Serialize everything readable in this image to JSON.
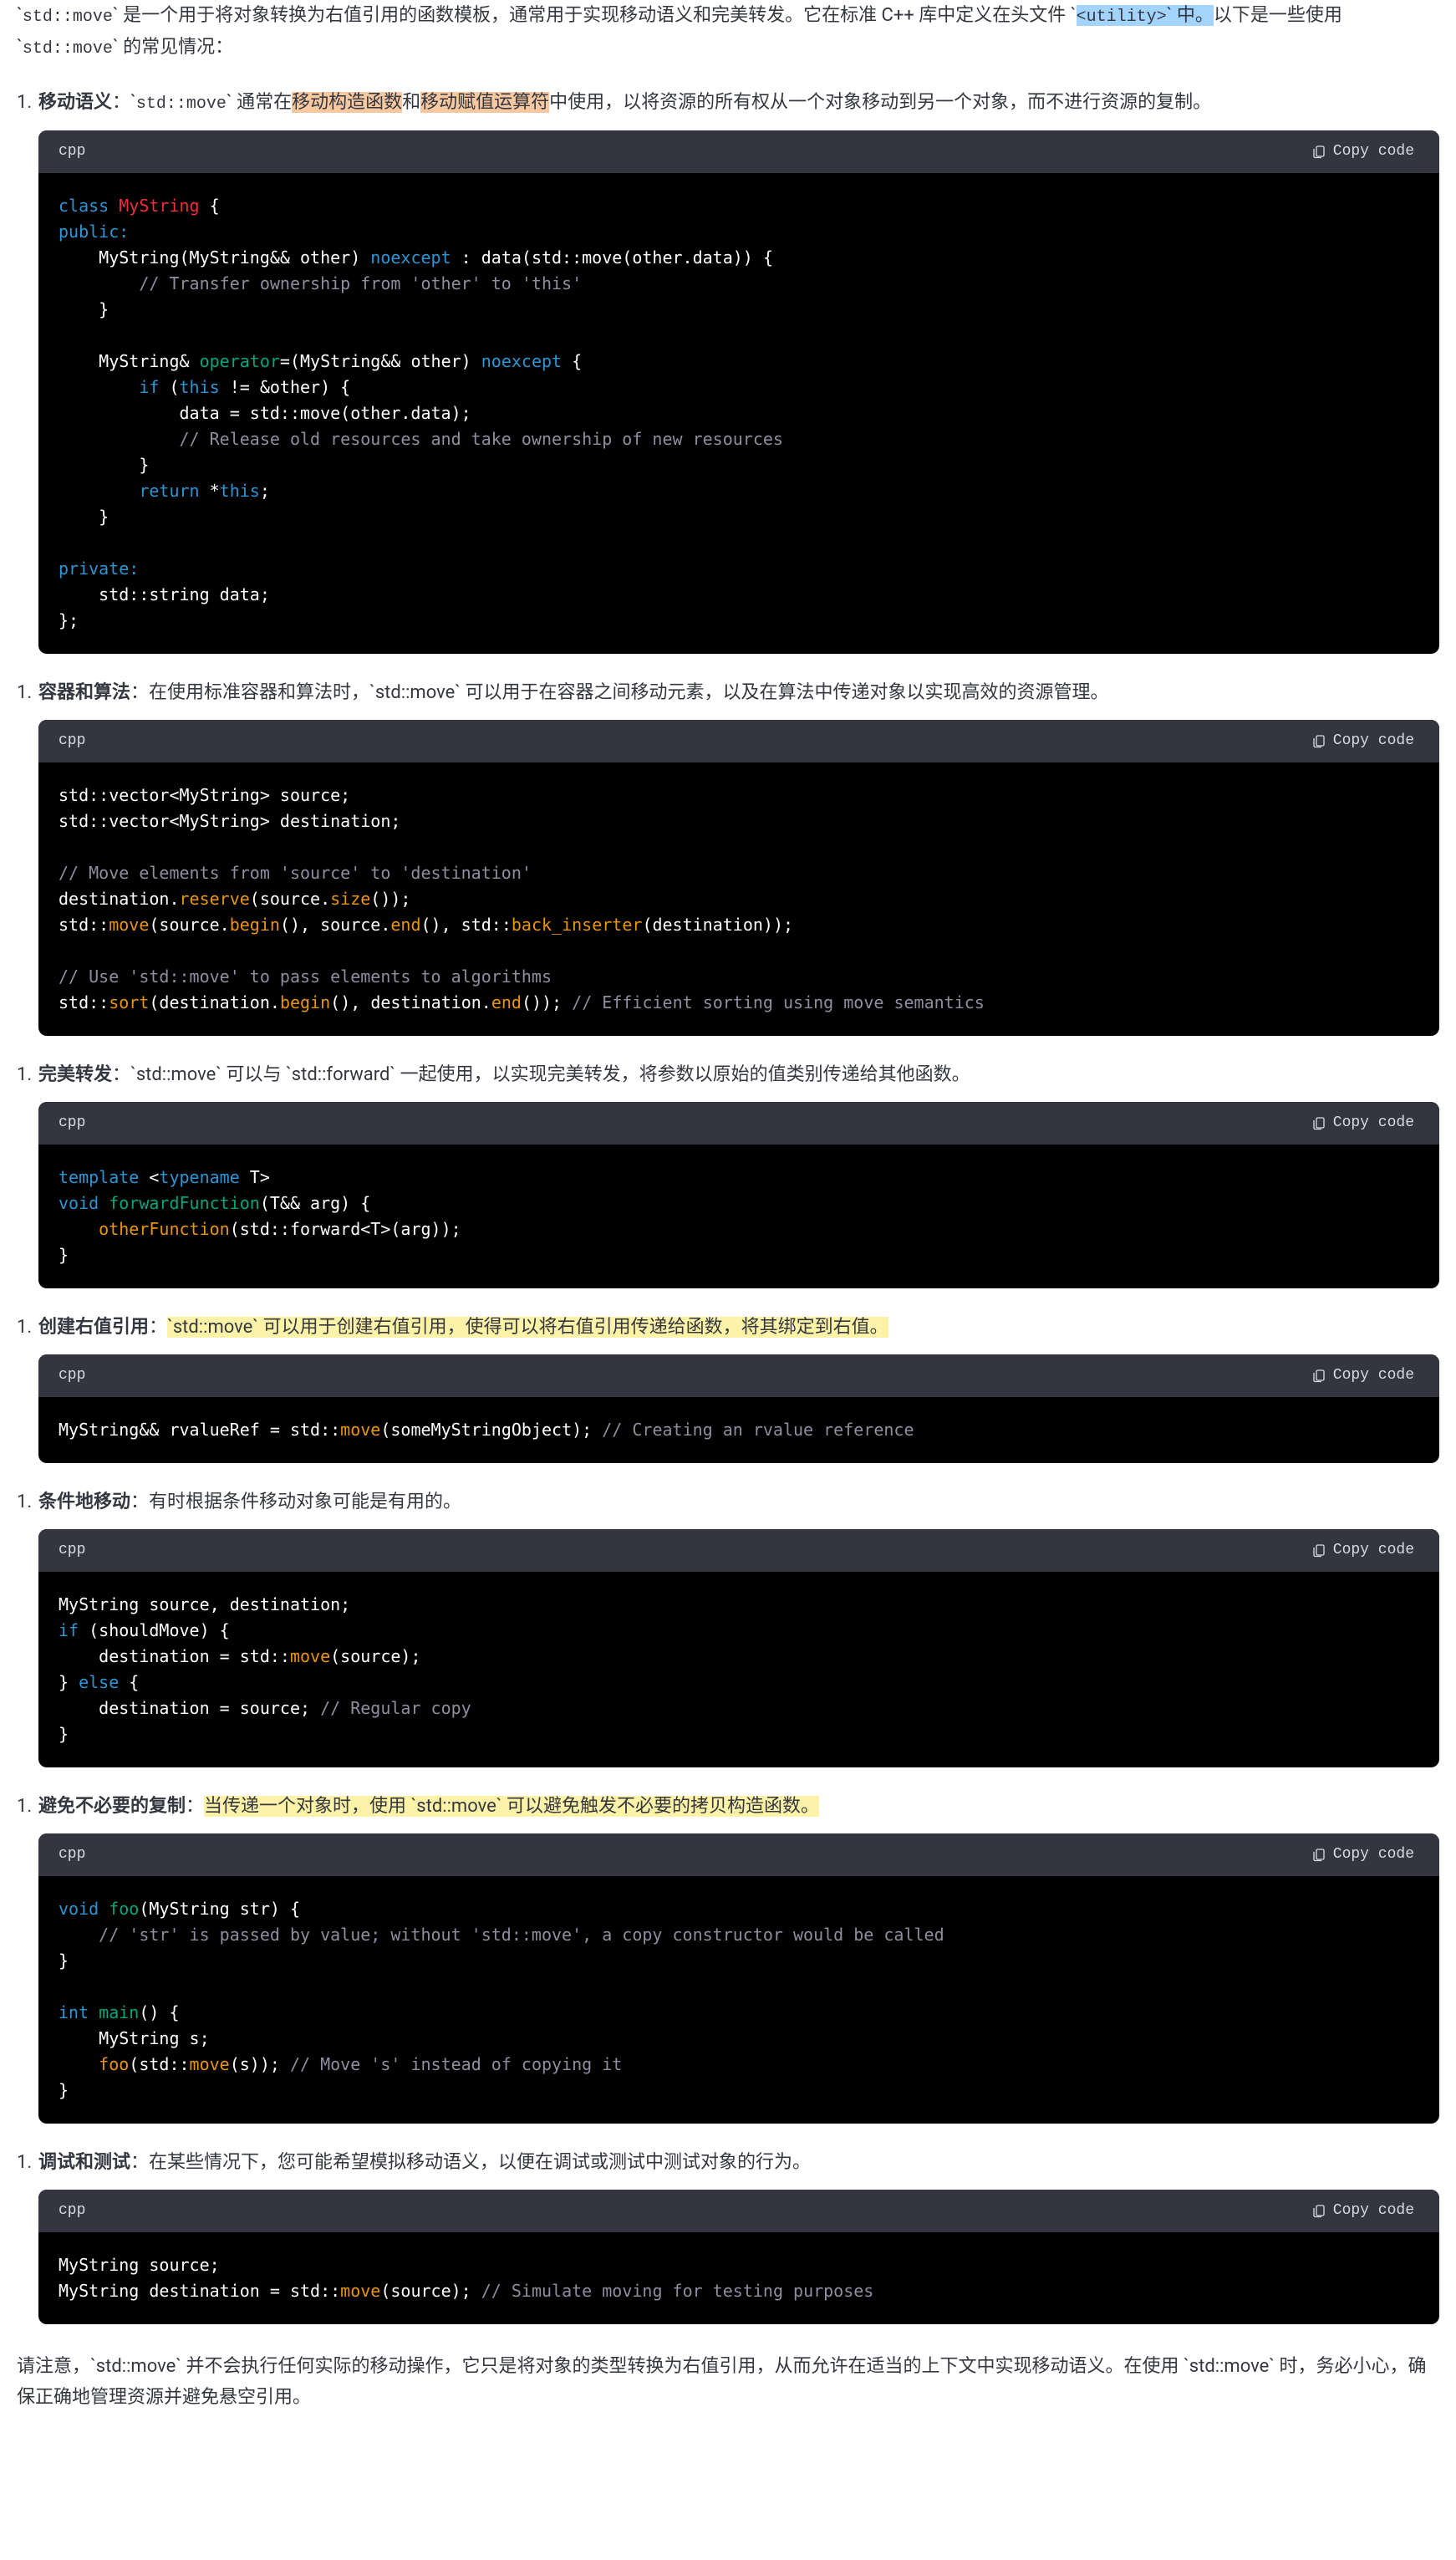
{
  "intro": {
    "pre1": "`",
    "code1": "std::move",
    "post1": "` 是一个用于将对象转换为右值引用的函数模板，通常用于实现移动语义和完美转发。它在标准 C++ 库中定义在头文件 `",
    "code2": "<utility>",
    "post2": "` 中。",
    "post3": "以下是一些使用 `",
    "code3": "std::move",
    "post4": "` 的常见情况："
  },
  "sections": [
    {
      "title": "移动语义",
      "desc_parts": {
        "a": "：`",
        "code": "std::move",
        "b": "` 通常在",
        "hl1": "移动构造函数",
        "mid": "和",
        "hl2": "移动赋值运算符",
        "c": "中使用，以将资源的所有权从一个对象移动到另一个对象，而不进行资源的复制。"
      },
      "lang": "cpp",
      "copy": "Copy code"
    },
    {
      "title": "容器和算法",
      "desc": "：在使用标准容器和算法时，`std::move` 可以用于在容器之间移动元素，以及在算法中传递对象以实现高效的资源管理。",
      "lang": "cpp",
      "copy": "Copy code"
    },
    {
      "title": "完美转发",
      "desc": "：`std::move` 可以与 `std::forward` 一起使用，以实现完美转发，将参数以原始的值类别传递给其他函数。",
      "lang": "cpp",
      "copy": "Copy code"
    },
    {
      "title": "创建右值引用",
      "desc_hl": "`std::move` 可以用于创建右值引用，使得可以将右值引用传递给函数，将其绑定到右值。",
      "lang": "cpp",
      "copy": "Copy code"
    },
    {
      "title": "条件地移动",
      "desc": "：有时根据条件移动对象可能是有用的。",
      "lang": "cpp",
      "copy": "Copy code"
    },
    {
      "title": "避免不必要的复制",
      "desc_hl": "当传递一个对象时，使用 `std::move` 可以避免触发不必要的拷贝构造函数。",
      "lang": "cpp",
      "copy": "Copy code"
    },
    {
      "title": "调试和测试",
      "desc": "：在某些情况下，您可能希望模拟移动语义，以便在调试或测试中测试对象的行为。",
      "lang": "cpp",
      "copy": "Copy code"
    }
  ],
  "outro": "请注意，`std::move` 并不会执行任何实际的移动操作，它只是将对象的类型转换为右值引用，从而允许在适当的上下文中实现移动语义。在使用 `std::move` 时，务必小心，确保正确地管理资源并避免悬空引用。",
  "code": {
    "b1": {
      "l1_a": "class ",
      "l1_b": "MyString",
      "l1_c": " {",
      "l2": "public:",
      "l3_a": "    MyString(MyString&& other) ",
      "l3_b": "noexcept",
      "l3_c": " : data(std::move(other.data)) {",
      "l4": "        // Transfer ownership from 'other' to 'this'",
      "l5": "    }",
      "l6": "",
      "l7_a": "    MyString& ",
      "l7_b": "operator",
      "l7_c": "=(MyString&& other) ",
      "l7_d": "noexcept",
      "l7_e": " {",
      "l8_a": "        if",
      "l8_b": " (",
      "l8_c": "this",
      "l8_d": " != &other) {",
      "l9": "            data = std::move(other.data);",
      "l10": "            // Release old resources and take ownership of new resources",
      "l11": "        }",
      "l12_a": "        return",
      "l12_b": " *",
      "l12_c": "this",
      "l12_d": ";",
      "l13": "    }",
      "l14": "",
      "l15": "private:",
      "l16": "    std::string data;",
      "l17": "};"
    },
    "b2": {
      "l1": "std::vector<MyString> source;",
      "l2": "std::vector<MyString> destination;",
      "l3": "",
      "l4": "// Move elements from 'source' to 'destination'",
      "l5_a": "destination.",
      "l5_b": "reserve",
      "l5_c": "(source.",
      "l5_d": "size",
      "l5_e": "());",
      "l6_a": "std::",
      "l6_b": "move",
      "l6_c": "(source.",
      "l6_d": "begin",
      "l6_e": "(), source.",
      "l6_f": "end",
      "l6_g": "(), std::",
      "l6_h": "back_inserter",
      "l6_i": "(destination));",
      "l7": "",
      "l8": "// Use 'std::move' to pass elements to algorithms",
      "l9_a": "std::",
      "l9_b": "sort",
      "l9_c": "(destination.",
      "l9_d": "begin",
      "l9_e": "(), destination.",
      "l9_f": "end",
      "l9_g": "()); ",
      "l9_h": "// Efficient sorting using move semantics"
    },
    "b3": {
      "l1_a": "template",
      "l1_b": " <",
      "l1_c": "typename",
      "l1_d": " T>",
      "l2_a": "void",
      "l2_b": " ",
      "l2_c": "forwardFunction",
      "l2_d": "(T&& arg) {",
      "l3_a": "    ",
      "l3_b": "otherFunction",
      "l3_c": "(std::forward<T>(arg));",
      "l4": "}"
    },
    "b4": {
      "l1_a": "MyString&& rvalueRef = std::",
      "l1_b": "move",
      "l1_c": "(someMyStringObject); ",
      "l1_d": "// Creating an rvalue reference"
    },
    "b5": {
      "l1": "MyString source, destination;",
      "l2_a": "if",
      "l2_b": " (shouldMove) {",
      "l3_a": "    destination = std::",
      "l3_b": "move",
      "l3_c": "(source);",
      "l4_a": "} ",
      "l4_b": "else",
      "l4_c": " {",
      "l5_a": "    destination = source; ",
      "l5_b": "// Regular copy",
      "l6": "}"
    },
    "b6": {
      "l1_a": "void",
      "l1_b": " ",
      "l1_c": "foo",
      "l1_d": "(MyString str) {",
      "l2": "    // 'str' is passed by value; without 'std::move', a copy constructor would be called",
      "l3": "}",
      "l4": "",
      "l5_a": "int",
      "l5_b": " ",
      "l5_c": "main",
      "l5_d": "() {",
      "l6": "    MyString s;",
      "l7_a": "    ",
      "l7_b": "foo",
      "l7_c": "(std::",
      "l7_d": "move",
      "l7_e": "(s)); ",
      "l7_f": "// Move 's' instead of copying it",
      "l8": "}"
    },
    "b7": {
      "l1": "MyString source;",
      "l2_a": "MyString destination = std::",
      "l2_b": "move",
      "l2_c": "(source); ",
      "l2_d": "// Simulate moving for testing purposes"
    }
  }
}
